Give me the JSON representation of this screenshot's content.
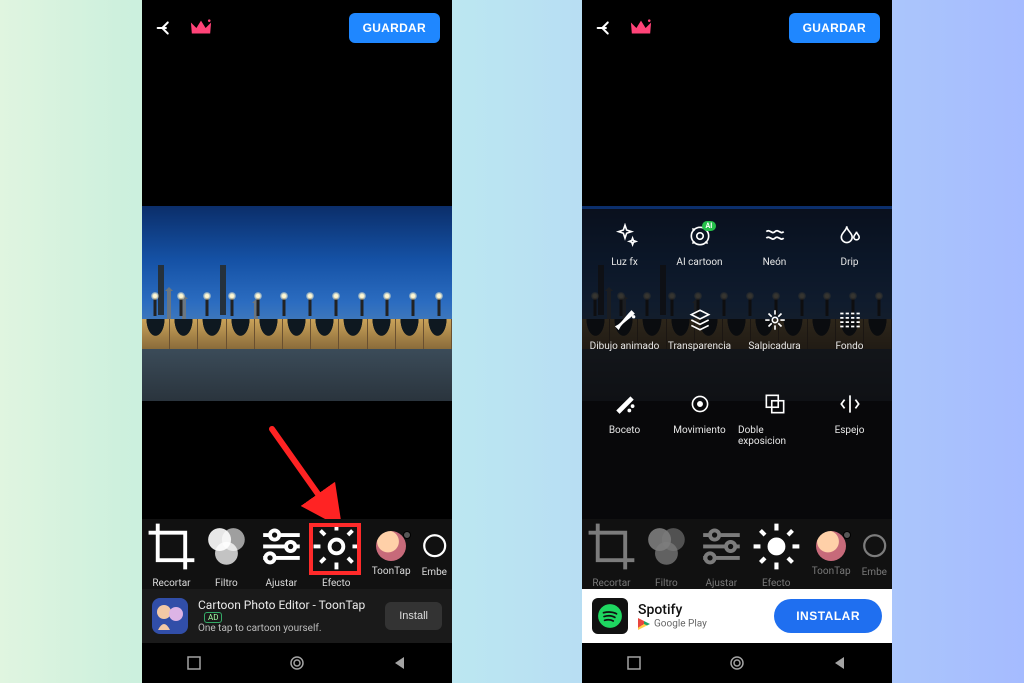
{
  "topbar": {
    "save_label": "GUARDAR"
  },
  "tools": {
    "recortar": "Recortar",
    "filtro": "Filtro",
    "ajustar": "Ajustar",
    "efecto": "Efecto",
    "toontap": "ToonTap",
    "embellecer": "Embe"
  },
  "effects": {
    "luzfx": "Luz fx",
    "ai_cartoon": "AI cartoon",
    "neon": "Neón",
    "drip": "Drip",
    "dibujo": "Dibujo animado",
    "transparencia": "Transparencia",
    "salpicadura": "Salpicadura",
    "fondo": "Fondo",
    "boceto": "Boceto",
    "movimiento": "Movimiento",
    "doble": "Doble exposicion",
    "espejo": "Espejo",
    "ai_badge": "AI"
  },
  "ad1": {
    "title": "Cartoon Photo Editor - ToonTap",
    "subtitle": "One tap to cartoon yourself.",
    "badge": "AD",
    "cta": "Install"
  },
  "ad2": {
    "title": "Spotify",
    "subtitle": "Google Play",
    "cta": "INSTALAR"
  }
}
